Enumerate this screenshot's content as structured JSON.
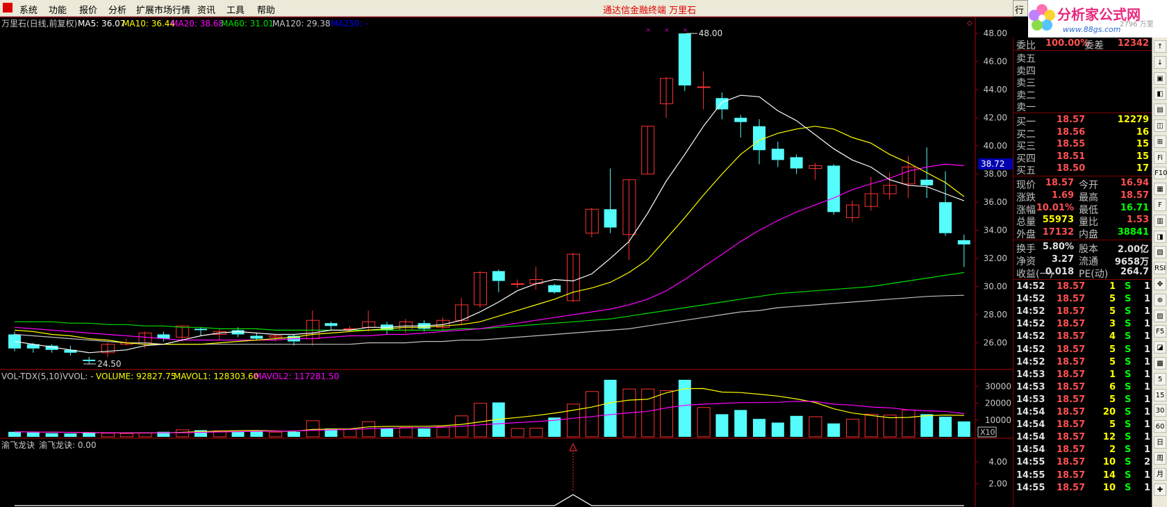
{
  "menu": {
    "items": [
      "系统",
      "功能",
      "报价",
      "分析",
      "扩展市场行情",
      "资讯",
      "工具",
      "帮助"
    ],
    "title": "通达信金融终端    万里石",
    "right_tab": "行"
  },
  "logo": {
    "name": "分析家公式网",
    "url_text": "www.88gs.com",
    "code_fragment": "2796 万里"
  },
  "kline": {
    "header": {
      "name": "万里石(日线,前复权)",
      "ma5": "MA5: 36.07",
      "ma10": "MA10: 36.44",
      "ma20": "MA20: 38.68",
      "ma60": "MA60: 31.01",
      "ma120": "MA120: 29.38",
      "ma250": "MA250: -"
    },
    "price_axis": [
      "48.00",
      "46.00",
      "44.00",
      "42.00",
      "40.00",
      "38.00",
      "36.00",
      "34.00",
      "32.00",
      "30.00",
      "28.00",
      "26.00"
    ],
    "high_label": "48.00",
    "low_label": "24.50",
    "cursor_price": "38.72",
    "colors": {
      "up": "#ff3232",
      "down": "#54fcfc",
      "ma5": "#ffffff",
      "ma10": "#ffff00",
      "ma20": "#ff00ff",
      "ma60": "#00e000",
      "ma120": "#c0c0c0",
      "ma250": "#0000ff"
    }
  },
  "volume": {
    "header": {
      "name": "VOL-TDX(5,10)",
      "vvol": "VVOL: -",
      "volume": "VOLUME: 92827.75",
      "mavol1": "MAVOL1: 128303.60",
      "mavol2": "MAVOL2: 117281.50"
    },
    "axis": [
      "30000",
      "20000",
      "10000"
    ],
    "unit": "X10"
  },
  "indicator": {
    "header": {
      "name": "渝飞龙诀",
      "value": "渝飞龙诀: 0.00"
    },
    "axis": [
      "4.00",
      "2.00"
    ]
  },
  "chart_data": {
    "type": "candlestick",
    "ylim": [
      24.5,
      48.5
    ],
    "candles": [
      {
        "o": 26.6,
        "c": 25.6,
        "h": 26.8,
        "l": 25.4
      },
      {
        "o": 25.9,
        "c": 25.6,
        "h": 26.0,
        "l": 25.3
      },
      {
        "o": 25.8,
        "c": 25.5,
        "h": 25.9,
        "l": 25.3
      },
      {
        "o": 25.5,
        "c": 25.3,
        "h": 25.8,
        "l": 25.1
      },
      {
        "o": 24.8,
        "c": 24.7,
        "h": 25.0,
        "l": 24.5
      },
      {
        "o": 25.3,
        "c": 25.9,
        "h": 26.0,
        "l": 25.0
      },
      {
        "o": 25.9,
        "c": 26.0,
        "h": 26.3,
        "l": 25.8
      },
      {
        "o": 26.0,
        "c": 26.7,
        "h": 26.8,
        "l": 25.6
      },
      {
        "o": 26.6,
        "c": 26.3,
        "h": 26.8,
        "l": 26.1
      },
      {
        "o": 26.4,
        "c": 27.2,
        "h": 27.2,
        "l": 26.1
      },
      {
        "o": 27.0,
        "c": 26.9,
        "h": 27.1,
        "l": 26.5
      },
      {
        "o": 26.6,
        "c": 26.8,
        "h": 27.0,
        "l": 26.2
      },
      {
        "o": 26.9,
        "c": 26.6,
        "h": 27.1,
        "l": 26.4
      },
      {
        "o": 26.5,
        "c": 26.3,
        "h": 26.7,
        "l": 26.2
      },
      {
        "o": 26.4,
        "c": 26.5,
        "h": 26.6,
        "l": 26.1
      },
      {
        "o": 26.5,
        "c": 26.1,
        "h": 26.6,
        "l": 25.8
      },
      {
        "o": 26.3,
        "c": 27.6,
        "h": 28.3,
        "l": 25.8
      },
      {
        "o": 27.4,
        "c": 27.2,
        "h": 27.5,
        "l": 26.9
      },
      {
        "o": 27.0,
        "c": 27.0,
        "h": 27.2,
        "l": 26.8
      },
      {
        "o": 27.1,
        "c": 27.5,
        "h": 28.3,
        "l": 26.8
      },
      {
        "o": 27.3,
        "c": 26.9,
        "h": 27.5,
        "l": 26.6
      },
      {
        "o": 26.9,
        "c": 27.5,
        "h": 27.7,
        "l": 26.7
      },
      {
        "o": 27.4,
        "c": 27.0,
        "h": 27.6,
        "l": 26.8
      },
      {
        "o": 27.1,
        "c": 27.6,
        "h": 27.8,
        "l": 26.9
      },
      {
        "o": 27.6,
        "c": 28.7,
        "h": 29.2,
        "l": 27.3
      },
      {
        "o": 28.7,
        "c": 31.0,
        "h": 31.1,
        "l": 28.5
      },
      {
        "o": 31.1,
        "c": 30.4,
        "h": 31.2,
        "l": 29.6
      },
      {
        "o": 30.2,
        "c": 30.2,
        "h": 30.5,
        "l": 29.9
      },
      {
        "o": 30.2,
        "c": 30.5,
        "h": 31.4,
        "l": 29.8
      },
      {
        "o": 30.1,
        "c": 29.6,
        "h": 30.2,
        "l": 29.5
      },
      {
        "o": 29.0,
        "c": 32.3,
        "h": 32.4,
        "l": 28.9
      },
      {
        "o": 33.8,
        "c": 35.5,
        "h": 35.6,
        "l": 33.5
      },
      {
        "o": 35.5,
        "c": 34.2,
        "h": 38.4,
        "l": 33.8
      },
      {
        "o": 33.7,
        "c": 37.6,
        "h": 37.6,
        "l": 31.9
      },
      {
        "o": 38.0,
        "c": 41.4,
        "h": 41.4,
        "l": 38.0
      },
      {
        "o": 43.0,
        "c": 44.8,
        "h": 44.9,
        "l": 42.0
      },
      {
        "o": 48.0,
        "c": 44.3,
        "h": 48.0,
        "l": 43.9
      },
      {
        "o": 44.2,
        "c": 44.2,
        "h": 45.3,
        "l": 42.6
      },
      {
        "o": 43.4,
        "c": 42.6,
        "h": 43.8,
        "l": 41.9
      },
      {
        "o": 42.0,
        "c": 41.7,
        "h": 42.2,
        "l": 40.6
      },
      {
        "o": 41.4,
        "c": 39.7,
        "h": 41.9,
        "l": 38.7
      },
      {
        "o": 39.8,
        "c": 39.0,
        "h": 40.3,
        "l": 38.5
      },
      {
        "o": 39.2,
        "c": 38.4,
        "h": 39.4,
        "l": 38.0
      },
      {
        "o": 38.4,
        "c": 38.6,
        "h": 38.8,
        "l": 37.6
      },
      {
        "o": 38.6,
        "c": 35.3,
        "h": 38.7,
        "l": 35.1
      },
      {
        "o": 34.9,
        "c": 35.8,
        "h": 36.1,
        "l": 34.6
      },
      {
        "o": 35.7,
        "c": 36.6,
        "h": 37.8,
        "l": 35.4
      },
      {
        "o": 36.6,
        "c": 37.2,
        "h": 38.1,
        "l": 36.2
      },
      {
        "o": 37.3,
        "c": 38.5,
        "h": 39.3,
        "l": 36.3
      },
      {
        "o": 37.6,
        "c": 37.2,
        "h": 39.9,
        "l": 36.3
      },
      {
        "o": 36.0,
        "c": 33.8,
        "h": 38.2,
        "l": 33.6
      },
      {
        "o": 33.3,
        "c": 33.0,
        "h": 33.7,
        "l": 31.4
      }
    ],
    "ma5": [
      26.1,
      25.9,
      25.7,
      25.5,
      25.3,
      25.4,
      25.5,
      25.8,
      25.9,
      26.2,
      26.5,
      26.7,
      26.8,
      26.7,
      26.6,
      26.6,
      26.7,
      26.9,
      26.9,
      27.1,
      27.1,
      27.2,
      27.2,
      27.3,
      27.6,
      28.2,
      28.9,
      29.7,
      30.2,
      30.5,
      30.4,
      30.9,
      32.0,
      33.2,
      35.2,
      37.5,
      39.4,
      41.4,
      43.1,
      43.6,
      43.5,
      42.5,
      41.8,
      40.8,
      39.8,
      39.0,
      38.5,
      37.6,
      37.2,
      37.1,
      36.6,
      36.1
    ],
    "ma10": [
      26.9,
      26.8,
      26.6,
      26.5,
      26.3,
      26.2,
      26.0,
      25.9,
      25.9,
      25.9,
      25.9,
      26.0,
      26.1,
      26.2,
      26.3,
      26.4,
      26.6,
      26.7,
      26.8,
      26.9,
      27.0,
      27.1,
      27.1,
      27.2,
      27.3,
      27.5,
      27.9,
      28.3,
      28.7,
      29.1,
      29.6,
      29.9,
      30.3,
      31.0,
      31.9,
      33.4,
      34.9,
      36.5,
      38.0,
      39.4,
      40.4,
      40.9,
      41.2,
      41.4,
      41.2,
      40.6,
      40.2,
      39.4,
      38.8,
      38.1,
      37.4,
      36.4
    ],
    "ma20": [
      27.1,
      27.0,
      26.9,
      26.8,
      26.7,
      26.6,
      26.5,
      26.4,
      26.3,
      26.2,
      26.2,
      26.2,
      26.2,
      26.2,
      26.2,
      26.3,
      26.3,
      26.4,
      26.5,
      26.5,
      26.6,
      26.6,
      26.7,
      26.8,
      26.9,
      27.0,
      27.2,
      27.4,
      27.6,
      27.8,
      28.0,
      28.2,
      28.4,
      28.7,
      29.1,
      29.7,
      30.5,
      31.4,
      32.3,
      33.2,
      34.0,
      34.7,
      35.3,
      35.8,
      36.3,
      36.9,
      37.3,
      37.7,
      38.2,
      38.5,
      38.7,
      38.6
    ],
    "ma60": [
      27.5,
      27.5,
      27.5,
      27.4,
      27.4,
      27.3,
      27.3,
      27.2,
      27.2,
      27.1,
      27.1,
      27.0,
      27.0,
      27.0,
      26.9,
      26.9,
      26.9,
      26.9,
      26.9,
      26.9,
      26.9,
      26.9,
      26.9,
      26.9,
      27.0,
      27.0,
      27.1,
      27.2,
      27.3,
      27.4,
      27.5,
      27.6,
      27.7,
      27.9,
      28.1,
      28.3,
      28.5,
      28.7,
      28.9,
      29.1,
      29.3,
      29.5,
      29.6,
      29.7,
      29.8,
      29.9,
      30.0,
      30.2,
      30.4,
      30.6,
      30.8,
      31.0
    ],
    "ma120": [
      26.6,
      26.5,
      26.4,
      26.3,
      26.2,
      26.1,
      26.0,
      26.0,
      25.9,
      25.9,
      25.9,
      25.9,
      25.9,
      25.9,
      25.9,
      25.9,
      25.9,
      25.9,
      25.9,
      26.0,
      26.0,
      26.0,
      26.1,
      26.1,
      26.2,
      26.2,
      26.3,
      26.4,
      26.5,
      26.6,
      26.7,
      26.8,
      26.9,
      27.0,
      27.2,
      27.4,
      27.6,
      27.8,
      28.0,
      28.2,
      28.3,
      28.5,
      28.6,
      28.7,
      28.8,
      28.9,
      29.0,
      29.1,
      29.2,
      29.3,
      29.35,
      29.38
    ],
    "vol_ylim": [
      0,
      36000
    ],
    "volumes": [
      3000,
      2600,
      2200,
      2000,
      2500,
      2200,
      2000,
      2400,
      3000,
      4200,
      4000,
      3600,
      3200,
      3800,
      2800,
      3000,
      9600,
      5000,
      4600,
      9000,
      5000,
      5600,
      5000,
      6000,
      12500,
      20000,
      20500,
      5000,
      5200,
      11500,
      19500,
      27000,
      34000,
      28500,
      28500,
      27500,
      34000,
      17500,
      13500,
      16000,
      10700,
      8500,
      12500,
      12000,
      8000,
      10500,
      13500,
      13000,
      16000,
      13500,
      12000,
      9200
    ],
    "mavol1": [
      3000,
      2900,
      2800,
      2600,
      2500,
      2400,
      2300,
      2300,
      2400,
      2700,
      3100,
      3400,
      3700,
      3800,
      3500,
      3300,
      4400,
      4600,
      4700,
      5900,
      6200,
      6300,
      6300,
      6600,
      7400,
      8900,
      10500,
      11500,
      12700,
      14100,
      15900,
      17700,
      20300,
      21900,
      22400,
      26200,
      28700,
      28800,
      26700,
      26400,
      25400,
      24300,
      22600,
      20500,
      16700,
      14200,
      12800,
      11400,
      11600,
      12600,
      13000,
      12800
    ],
    "mavol2": [
      3000,
      2900,
      2800,
      2700,
      2600,
      2500,
      2400,
      2400,
      2400,
      2500,
      2700,
      2900,
      3100,
      3300,
      3400,
      3500,
      3900,
      4200,
      4400,
      4800,
      5100,
      5300,
      5500,
      5700,
      6300,
      7100,
      7800,
      8500,
      9100,
      9900,
      11100,
      12100,
      13300,
      14300,
      15200,
      17200,
      18800,
      19500,
      19900,
      20400,
      20400,
      20600,
      21200,
      21100,
      19500,
      18900,
      17800,
      17300,
      16100,
      15500,
      15200,
      13800
    ],
    "indicator_values": [
      0,
      0,
      0,
      0,
      0,
      0,
      0,
      0,
      0,
      0,
      0,
      0,
      0,
      0,
      0,
      0,
      0,
      0,
      0,
      0,
      0,
      0,
      0,
      0,
      0,
      0,
      0,
      0,
      0,
      0,
      1.0,
      0,
      0,
      0,
      0,
      0,
      0,
      0,
      0,
      0,
      0,
      0,
      0,
      0,
      0,
      0,
      0,
      0,
      0,
      0,
      0,
      0
    ],
    "indicator_ylim": [
      0,
      5
    ]
  },
  "quote": {
    "weibi_label": "委比",
    "weibi_val": "100.00%",
    "weicha_label": "委差",
    "weicha_val": "12342",
    "sell": [
      {
        "label": "卖五",
        "price": "",
        "vol": ""
      },
      {
        "label": "卖四",
        "price": "",
        "vol": ""
      },
      {
        "label": "卖三",
        "price": "",
        "vol": ""
      },
      {
        "label": "卖二",
        "price": "",
        "vol": ""
      },
      {
        "label": "卖一",
        "price": "",
        "vol": ""
      }
    ],
    "buy": [
      {
        "label": "买一",
        "price": "18.57",
        "vol": "12279"
      },
      {
        "label": "买二",
        "price": "18.56",
        "vol": "16"
      },
      {
        "label": "买三",
        "price": "18.55",
        "vol": "15"
      },
      {
        "label": "买四",
        "price": "18.51",
        "vol": "15"
      },
      {
        "label": "买五",
        "price": "18.50",
        "vol": "17"
      }
    ],
    "stats": [
      {
        "l1": "现价",
        "v1": "18.57",
        "l2": "今开",
        "v2": "16.94",
        "c1": "#ff5050",
        "c2": "#ff5050"
      },
      {
        "l1": "涨跌",
        "v1": "1.69",
        "l2": "最高",
        "v2": "18.57",
        "c1": "#ff5050",
        "c2": "#ff5050"
      },
      {
        "l1": "涨幅",
        "v1": "10.01%",
        "l2": "最低",
        "v2": "16.71",
        "c1": "#ff5050",
        "c2": "#00ff00"
      },
      {
        "l1": "总量",
        "v1": "55973",
        "l2": "量比",
        "v2": "1.53",
        "c1": "#ffff00",
        "c2": "#ff5050"
      },
      {
        "l1": "外盘",
        "v1": "17132",
        "l2": "内盘",
        "v2": "38841",
        "c1": "#ff5050",
        "c2": "#00ff00"
      }
    ],
    "fund": [
      {
        "l1": "换手",
        "v1": "5.80%",
        "l2": "股本",
        "v2": "2.00亿"
      },
      {
        "l1": "净资",
        "v1": "3.27",
        "l2": "流通",
        "v2": "9658万"
      },
      {
        "l1": "收益(一)",
        "v1": "0.018",
        "l2": "PE(动)",
        "v2": "264.7"
      }
    ],
    "ticks": [
      {
        "t": "14:52",
        "p": "18.57",
        "v": "1",
        "s": "S",
        "n": "1"
      },
      {
        "t": "14:52",
        "p": "18.57",
        "v": "5",
        "s": "S",
        "n": "1"
      },
      {
        "t": "14:52",
        "p": "18.57",
        "v": "5",
        "s": "S",
        "n": "1"
      },
      {
        "t": "14:52",
        "p": "18.57",
        "v": "3",
        "s": "S",
        "n": "1"
      },
      {
        "t": "14:52",
        "p": "18.57",
        "v": "4",
        "s": "S",
        "n": "1"
      },
      {
        "t": "14:52",
        "p": "18.57",
        "v": "5",
        "s": "S",
        "n": "1"
      },
      {
        "t": "14:52",
        "p": "18.57",
        "v": "5",
        "s": "S",
        "n": "1"
      },
      {
        "t": "14:53",
        "p": "18.57",
        "v": "1",
        "s": "S",
        "n": "1"
      },
      {
        "t": "14:53",
        "p": "18.57",
        "v": "6",
        "s": "S",
        "n": "1"
      },
      {
        "t": "14:53",
        "p": "18.57",
        "v": "5",
        "s": "S",
        "n": "1"
      },
      {
        "t": "14:54",
        "p": "18.57",
        "v": "20",
        "s": "S",
        "n": "1"
      },
      {
        "t": "14:54",
        "p": "18.57",
        "v": "5",
        "s": "S",
        "n": "1"
      },
      {
        "t": "14:54",
        "p": "18.57",
        "v": "12",
        "s": "S",
        "n": "1"
      },
      {
        "t": "14:54",
        "p": "18.57",
        "v": "2",
        "s": "S",
        "n": "1"
      },
      {
        "t": "14:55",
        "p": "18.57",
        "v": "10",
        "s": "S",
        "n": "2"
      },
      {
        "t": "14:55",
        "p": "18.57",
        "v": "14",
        "s": "S",
        "n": "1"
      },
      {
        "t": "14:55",
        "p": "18.57",
        "v": "10",
        "s": "S",
        "n": "1"
      }
    ]
  },
  "toolbar": {
    "buttons": [
      "↑",
      "↓",
      "▣",
      "◧",
      "▤",
      "◫",
      "⊞",
      "Fi",
      "F10",
      "▦",
      "F",
      "▥",
      "◨",
      "▧",
      "RSI",
      "✥",
      "⊕",
      "▨",
      "F5",
      "◪",
      "▩",
      "5",
      "15",
      "30",
      "60",
      "日",
      "周",
      "月",
      "✚"
    ]
  }
}
